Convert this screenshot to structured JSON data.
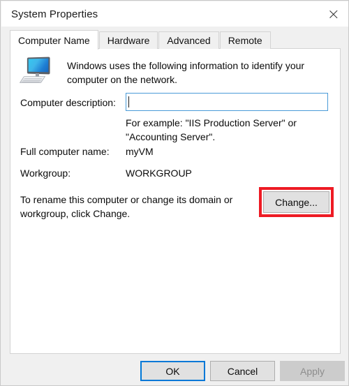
{
  "window": {
    "title": "System Properties",
    "close_icon": "close-icon"
  },
  "tabs": [
    {
      "label": "Computer Name",
      "selected": true
    },
    {
      "label": "Hardware",
      "selected": false
    },
    {
      "label": "Advanced",
      "selected": false
    },
    {
      "label": "Remote",
      "selected": false
    }
  ],
  "content": {
    "icon": "computer-monitor-icon",
    "intro_line1": "Windows uses the following information to identify your",
    "intro_line2": "computer on the network.",
    "computer_description": {
      "label": "Computer description:",
      "value": "",
      "placeholder": "",
      "hint_line1": "For example: \"IIS Production Server\" or",
      "hint_line2": "\"Accounting Server\"."
    },
    "full_computer_name": {
      "label": "Full computer name:",
      "value": "myVM"
    },
    "workgroup": {
      "label": "Workgroup:",
      "value": "WORKGROUP"
    },
    "rename_line1": "To rename this computer or change its domain or",
    "rename_line2": "workgroup, click Change.",
    "change_button": "Change..."
  },
  "footer": {
    "ok": "OK",
    "cancel": "Cancel",
    "apply": "Apply"
  },
  "colors": {
    "highlight": "#ee1b24",
    "focus": "#0078d7",
    "input_focus": "#4a9bd8"
  }
}
